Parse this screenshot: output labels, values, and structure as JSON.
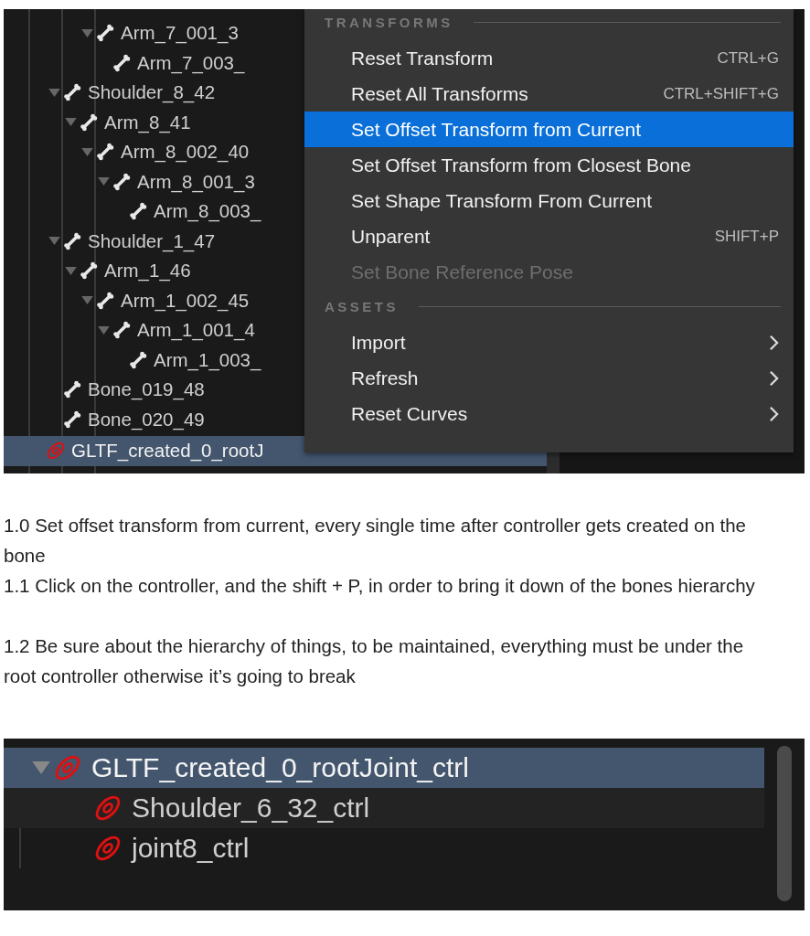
{
  "outliner_top": {
    "tree": [
      {
        "label": "Arm_7_001_3",
        "kind": "bone",
        "continued": true,
        "expanded": true,
        "selected": false,
        "children": [
          {
            "label": "Arm_7_003_",
            "kind": "bone",
            "selected": false
          }
        ]
      },
      {
        "label": "Shoulder_8_42",
        "kind": "bone",
        "expanded": true,
        "selected": false,
        "children": [
          {
            "label": "Arm_8_41",
            "kind": "bone",
            "expanded": true,
            "selected": false,
            "children": [
              {
                "label": "Arm_8_002_40",
                "kind": "bone",
                "expanded": true,
                "selected": false,
                "children": [
                  {
                    "label": "Arm_8_001_3",
                    "kind": "bone",
                    "expanded": true,
                    "selected": false,
                    "children": [
                      {
                        "label": "Arm_8_003_",
                        "kind": "bone",
                        "selected": false
                      }
                    ]
                  }
                ]
              }
            ]
          }
        ]
      },
      {
        "label": "Shoulder_1_47",
        "kind": "bone",
        "expanded": true,
        "selected": false,
        "children": [
          {
            "label": "Arm_1_46",
            "kind": "bone",
            "expanded": true,
            "selected": false,
            "children": [
              {
                "label": "Arm_1_002_45",
                "kind": "bone",
                "expanded": true,
                "selected": false,
                "children": [
                  {
                    "label": "Arm_1_001_4",
                    "kind": "bone",
                    "expanded": true,
                    "selected": false,
                    "children": [
                      {
                        "label": "Arm_1_003_",
                        "kind": "bone",
                        "selected": false
                      }
                    ]
                  }
                ]
              }
            ]
          }
        ]
      },
      {
        "label": "Bone_019_48",
        "kind": "bone",
        "selected": false
      },
      {
        "label": "Bone_020_49",
        "kind": "bone",
        "selected": false
      },
      {
        "label": "GLTF_created_0_rootJ",
        "kind": "controller",
        "root": true,
        "selected": true
      }
    ],
    "context_menu": {
      "sections": [
        {
          "title": "TRANSFORMS",
          "items": [
            {
              "label": "Reset Transform",
              "shortcut": "CTRL+G",
              "selected": false,
              "disabled": false
            },
            {
              "label": "Reset All Transforms",
              "shortcut": "CTRL+SHIFT+G",
              "selected": false,
              "disabled": false
            },
            {
              "label": "Set Offset Transform from Current",
              "selected": true,
              "disabled": false
            },
            {
              "label": "Set Offset Transform from Closest Bone",
              "selected": false,
              "disabled": false
            },
            {
              "label": "Set Shape Transform From Current",
              "selected": false,
              "disabled": false
            },
            {
              "label": "Unparent",
              "shortcut": "SHIFT+P",
              "selected": false,
              "disabled": false
            },
            {
              "label": "Set Bone Reference Pose",
              "selected": false,
              "disabled": true
            }
          ]
        },
        {
          "title": "ASSETS",
          "items": [
            {
              "label": "Import",
              "submenu": true,
              "selected": false,
              "disabled": false
            },
            {
              "label": "Refresh",
              "submenu": true,
              "selected": false,
              "disabled": false
            },
            {
              "label": "Reset Curves",
              "submenu": true,
              "selected": false,
              "disabled": false
            }
          ]
        }
      ]
    }
  },
  "notes": [
    "1.0 Set offset transform from current, every single time after controller gets created on the bone",
    "1.1 Click on the controller, and the shift + P, in order to bring it down of the bones hierarchy",
    "1.2 Be sure about the hierarchy of things, to be maintained, everything must be under the root controller otherwise it’s going to break"
  ],
  "outliner_bottom": {
    "tree": [
      {
        "label": "GLTF_created_0_rootJoint_ctrl",
        "kind": "controller",
        "expanded": true,
        "selected": true,
        "children": [
          {
            "label": "Shoulder_6_32_ctrl",
            "kind": "controller",
            "selected": false
          },
          {
            "label": "joint8_ctrl",
            "kind": "controller",
            "selected": false
          }
        ]
      }
    ]
  }
}
